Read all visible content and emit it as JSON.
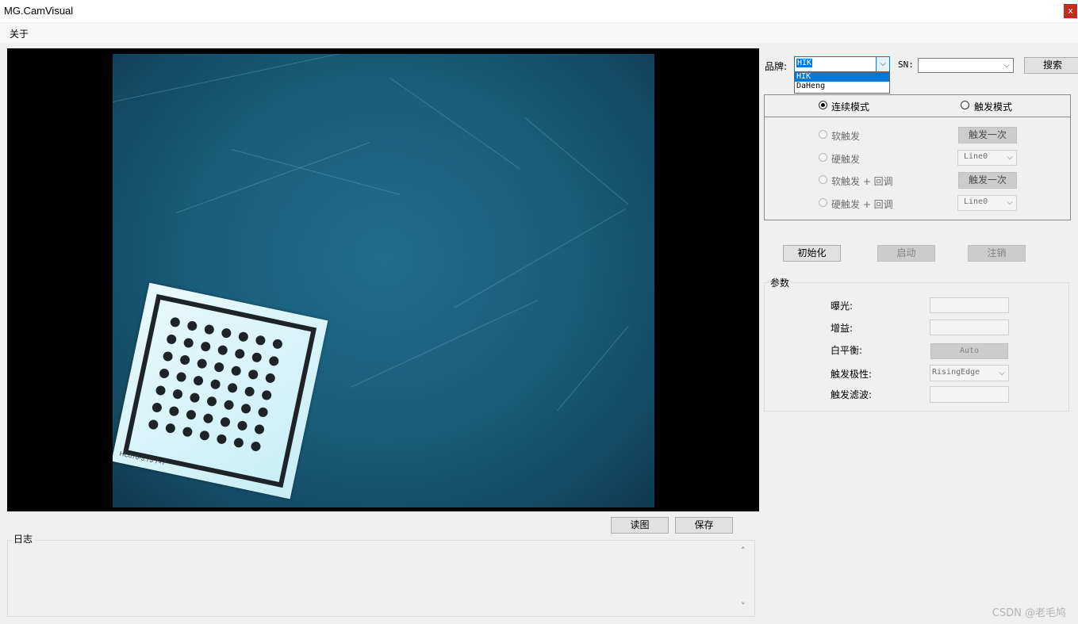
{
  "window": {
    "title": "MG.CamVisual",
    "close_glyph": "x"
  },
  "menu": {
    "about": "关于"
  },
  "image": {
    "target_label": "HC070-3.75  7×7"
  },
  "image_buttons": {
    "read": "读图",
    "save": "保存"
  },
  "log": {
    "label": "日志",
    "scroll_up": "˄",
    "scroll_down": "˅"
  },
  "brand": {
    "label": "品牌:",
    "selected": "HIK",
    "options": [
      "HIK",
      "DaHeng"
    ],
    "dropdown_open": true
  },
  "sn": {
    "label": "SN:",
    "value": ""
  },
  "search_button": "搜索",
  "mode": {
    "continuous": "连续模式",
    "trigger": "触发模式",
    "selected": "continuous"
  },
  "trigger_options": [
    {
      "label": "软触发",
      "control": "button",
      "control_label": "触发一次"
    },
    {
      "label": "硬触发",
      "control": "select",
      "control_label": "Line0"
    },
    {
      "label": "软触发 + 回调",
      "control": "button",
      "control_label": "触发一次"
    },
    {
      "label": "硬触发 + 回调",
      "control": "select",
      "control_label": "Line0"
    }
  ],
  "actions": {
    "init": "初始化",
    "start": "启动",
    "logout": "注销"
  },
  "params": {
    "title": "参数",
    "exposure_label": "曝光:",
    "gain_label": "增益:",
    "white_balance_label": "白平衡:",
    "white_balance_button": "Auto",
    "trigger_polarity_label": "触发极性:",
    "trigger_polarity_value": "RisingEdge",
    "trigger_filter_label": "触发滤波:"
  },
  "watermark": "CSDN @老毛鸠",
  "colors": {
    "accent": "#0078d7",
    "close": "#c42b1c",
    "image_bg": "#1a5f7d"
  },
  "icons": {
    "dropdown": "chevron-down-icon",
    "close": "close-icon"
  }
}
